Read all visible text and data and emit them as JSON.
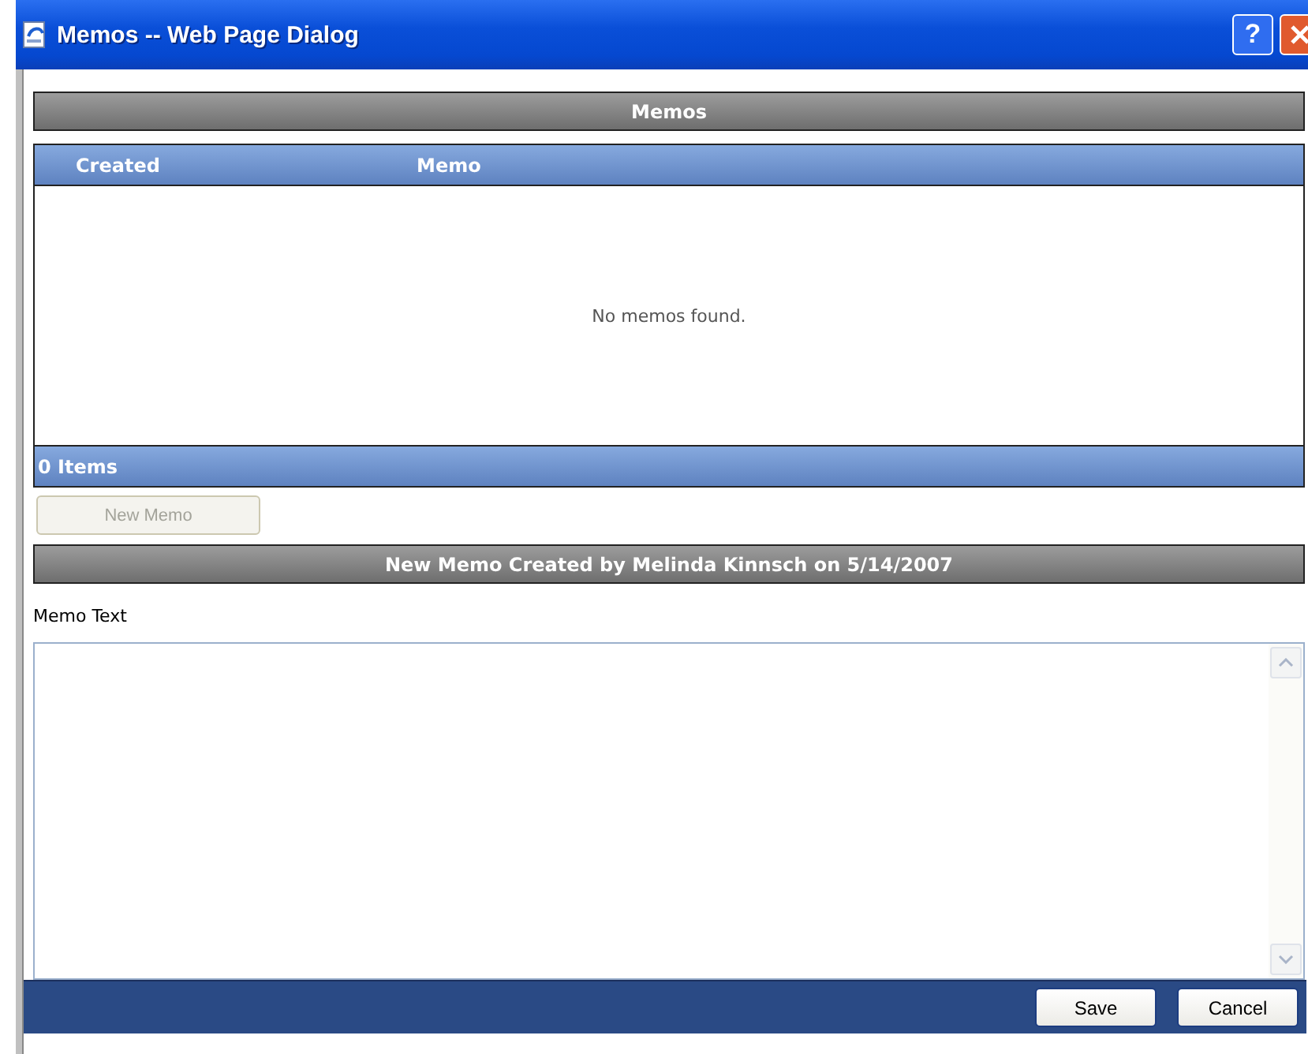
{
  "window": {
    "title": "Memos -- Web Page Dialog",
    "help_button": "?"
  },
  "memos": {
    "title": "Memos",
    "columns": [
      "Created",
      "Memo"
    ],
    "empty_text": "No memos found.",
    "footer": "0 Items"
  },
  "new_memo_button": {
    "label": "New Memo",
    "disabled": true
  },
  "new_memo": {
    "title": "New Memo Created by Melinda Kinnsch on 5/14/2007",
    "field_label": "Memo Text"
  },
  "buttons": [
    "Save",
    "Cancel"
  ]
}
